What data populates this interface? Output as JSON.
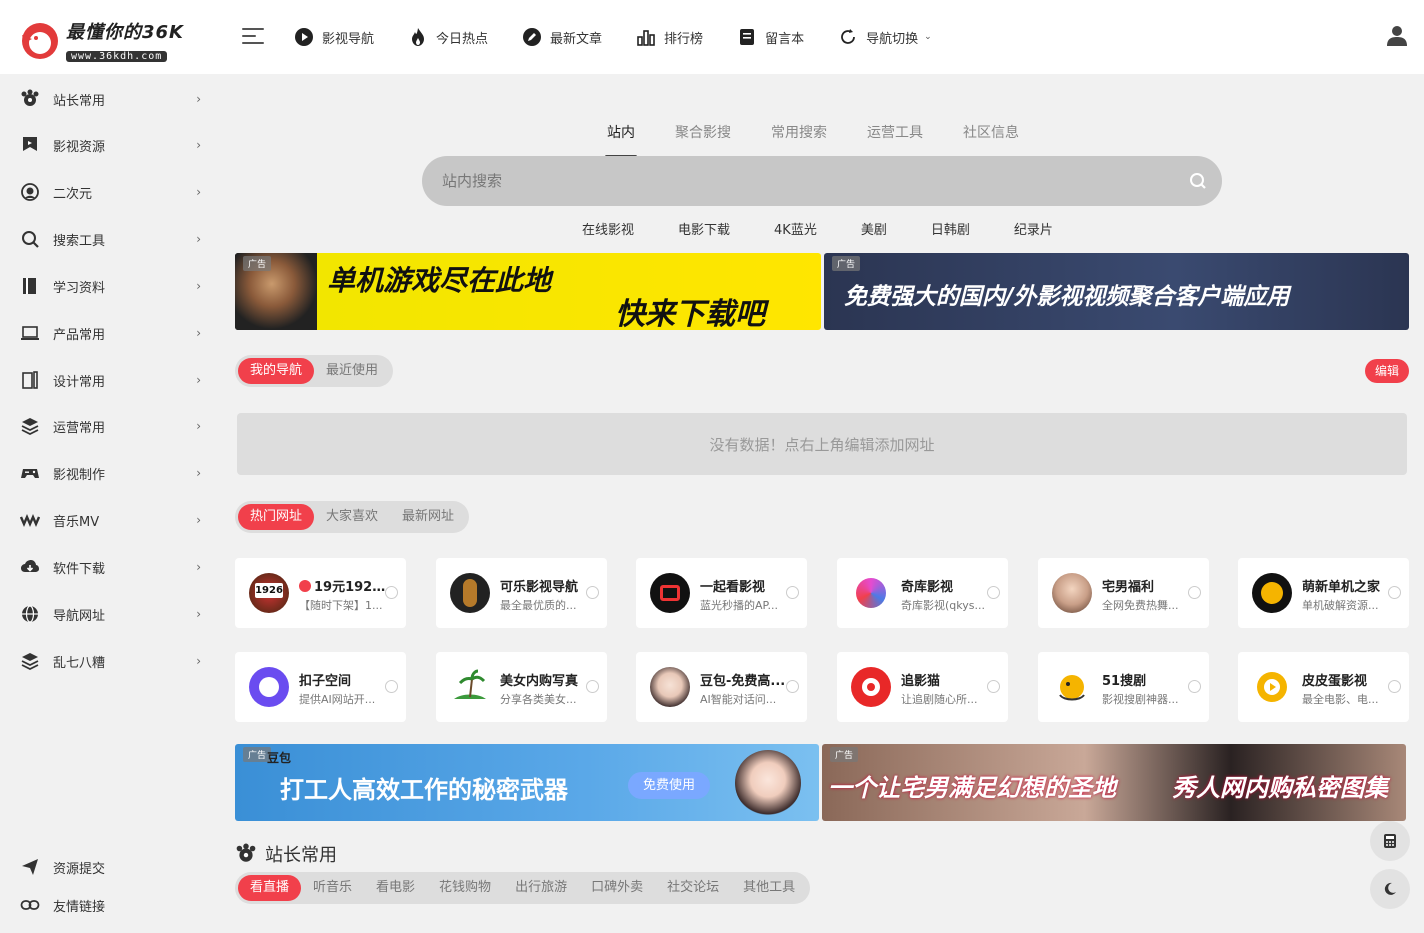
{
  "logo": {
    "title": "最懂你的36K",
    "url": "www.36kdh.com"
  },
  "nav": [
    {
      "label": "影视导航",
      "icon": "play-circle-icon"
    },
    {
      "label": "今日热点",
      "icon": "flame-icon"
    },
    {
      "label": "最新文章",
      "icon": "pen-circle-icon"
    },
    {
      "label": "排行榜",
      "icon": "bar-chart-icon"
    },
    {
      "label": "留言本",
      "icon": "message-book-icon"
    },
    {
      "label": "导航切换",
      "icon": "refresh-icon",
      "has_dropdown": true
    }
  ],
  "sidebar": {
    "items": [
      {
        "label": "站长常用",
        "icon": "tool-group-icon"
      },
      {
        "label": "影视资源",
        "icon": "film-flag-icon"
      },
      {
        "label": "二次元",
        "icon": "anime-face-icon"
      },
      {
        "label": "搜索工具",
        "icon": "search-icon"
      },
      {
        "label": "学习资料",
        "icon": "book-icon"
      },
      {
        "label": "产品常用",
        "icon": "laptop-icon"
      },
      {
        "label": "设计常用",
        "icon": "design-icon"
      },
      {
        "label": "运营常用",
        "icon": "layers-icon"
      },
      {
        "label": "影视制作",
        "icon": "gamepad-icon"
      },
      {
        "label": "音乐MV",
        "icon": "music-wave-icon"
      },
      {
        "label": "软件下载",
        "icon": "cloud-download-icon"
      },
      {
        "label": "导航网址",
        "icon": "globe-icon"
      },
      {
        "label": "乱七八糟",
        "icon": "stack-icon"
      }
    ],
    "footer": [
      {
        "label": "资源提交",
        "icon": "send-icon"
      },
      {
        "label": "友情链接",
        "icon": "link-icon"
      }
    ]
  },
  "search": {
    "tabs": [
      "站内",
      "聚合影搜",
      "常用搜索",
      "运营工具",
      "社区信息"
    ],
    "active_tab": 0,
    "placeholder": "站内搜索",
    "quick_links": [
      "在线影视",
      "电影下载",
      "4K蓝光",
      "美剧",
      "日韩剧",
      "纪录片"
    ]
  },
  "banners_top": [
    {
      "tag": "广告",
      "line1": "单机游戏尽在此地",
      "line2": "快来下载吧"
    },
    {
      "tag": "广告",
      "text": "免费强大的国内/外影视视频聚合客户端应用"
    }
  ],
  "my_nav": {
    "tabs": [
      "我的导航",
      "最近使用"
    ],
    "edit_label": "编辑",
    "empty_text": "没有数据！点右上角编辑添加网址"
  },
  "hot": {
    "tabs": [
      "热门网址",
      "大家喜欢",
      "最新网址"
    ],
    "cards": [
      {
        "name": "19元192...",
        "desc": "【随时下架】1...",
        "badge": "1926"
      },
      {
        "name": "可乐影视导航",
        "desc": "最全最优质的..."
      },
      {
        "name": "一起看影视",
        "desc": "蓝光秒播的AP..."
      },
      {
        "name": "奇库影视",
        "desc": "奇库影视(qkys..."
      },
      {
        "name": "宅男福利",
        "desc": "全网免费热舞..."
      },
      {
        "name": "萌新单机之家",
        "desc": "单机破解资源..."
      },
      {
        "name": "扣子空间",
        "desc": "提供AI网站开..."
      },
      {
        "name": "美女内购写真",
        "desc": "分享各类美女..."
      },
      {
        "name": "豆包-免费高...",
        "desc": "AI智能对话问..."
      },
      {
        "name": "追影猫",
        "desc": "让追剧随心所..."
      },
      {
        "name": "51搜剧",
        "desc": "影视搜剧神器..."
      },
      {
        "name": "皮皮蛋影视",
        "desc": "最全电影、电..."
      }
    ]
  },
  "banners_bottom": [
    {
      "tag": "广告",
      "brand": "豆包",
      "text": "打工人高效工作的秘密武器",
      "cta": "免费使用"
    },
    {
      "tag": "广告",
      "text1": "一个让宅男满足幻想的圣地",
      "text2": "秀人网内购私密图集"
    }
  ],
  "section": {
    "title": "站长常用",
    "tabs": [
      "看直播",
      "听音乐",
      "看电影",
      "花钱购物",
      "出行旅游",
      "口碑外卖",
      "社交论坛",
      "其他工具"
    ]
  },
  "colors": {
    "accent": "#f1404b",
    "background": "#f1f1f1"
  }
}
